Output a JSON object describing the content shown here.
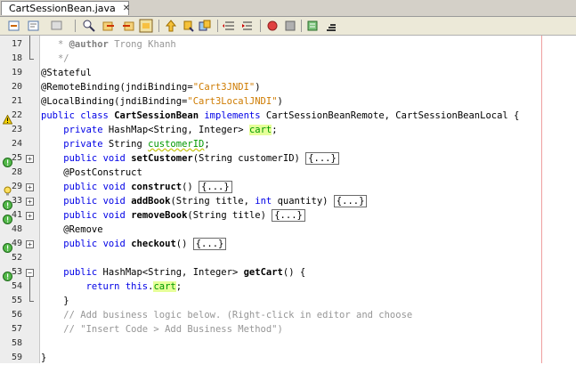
{
  "tab": {
    "filename": "CartSessionBean.java"
  },
  "colors": {
    "keyword": "#0000e6",
    "string": "#ce7b00",
    "field": "#009900",
    "comment": "#969696",
    "highlight": "#e6ff99"
  },
  "toolbar": {
    "icons": [
      "back-icon",
      "history-icon",
      "find-icon",
      "find-prev-icon",
      "find-next-icon",
      "toggle-highlight-icon",
      "prev-bookmark-icon",
      "next-bookmark-icon",
      "toggle-bookmark-icon",
      "shift-left-icon",
      "shift-right-icon",
      "record-macro-icon",
      "stop-macro-icon",
      "comment-icon",
      "uncomment-icon"
    ]
  },
  "lines": [
    {
      "n": "17",
      "text": "   * @author Trong Khanh"
    },
    {
      "n": "18",
      "text": "   */"
    },
    {
      "n": "19",
      "text": "@Stateful"
    },
    {
      "n": "20",
      "text": "@RemoteBinding(jndiBinding=\"Cart3JNDI\")"
    },
    {
      "n": "21",
      "text": "@LocalBinding(jndiBinding=\"Cart3LocalJNDI\")"
    },
    {
      "n": "22",
      "text": "public class CartSessionBean implements CartSessionBeanRemote, CartSessionBeanLocal {"
    },
    {
      "n": "23",
      "text": "    private HashMap<String, Integer> cart;"
    },
    {
      "n": "24",
      "text": "    private String customerID;"
    },
    {
      "n": "25",
      "text": "    public void setCustomer(String customerID) {...}"
    },
    {
      "n": "28",
      "text": "    @PostConstruct"
    },
    {
      "n": "29",
      "text": "    public void construct() {...}"
    },
    {
      "n": "33",
      "text": "    public void addBook(String title, int quantity) {...}"
    },
    {
      "n": "41",
      "text": "    public void removeBook(String title) {...}"
    },
    {
      "n": "48",
      "text": "    @Remove"
    },
    {
      "n": "49",
      "text": "    public void checkout() {...}"
    },
    {
      "n": "52",
      "text": ""
    },
    {
      "n": "53",
      "text": "    public HashMap<String, Integer> getCart() {"
    },
    {
      "n": "54",
      "text": "        return this.cart;"
    },
    {
      "n": "55",
      "text": "    }"
    },
    {
      "n": "56",
      "text": "    // Add business logic below. (Right-click in editor and choose"
    },
    {
      "n": "57",
      "text": "    // \"Insert Code > Add Business Method\")"
    },
    {
      "n": "58",
      "text": ""
    },
    {
      "n": "59",
      "text": "}"
    }
  ]
}
